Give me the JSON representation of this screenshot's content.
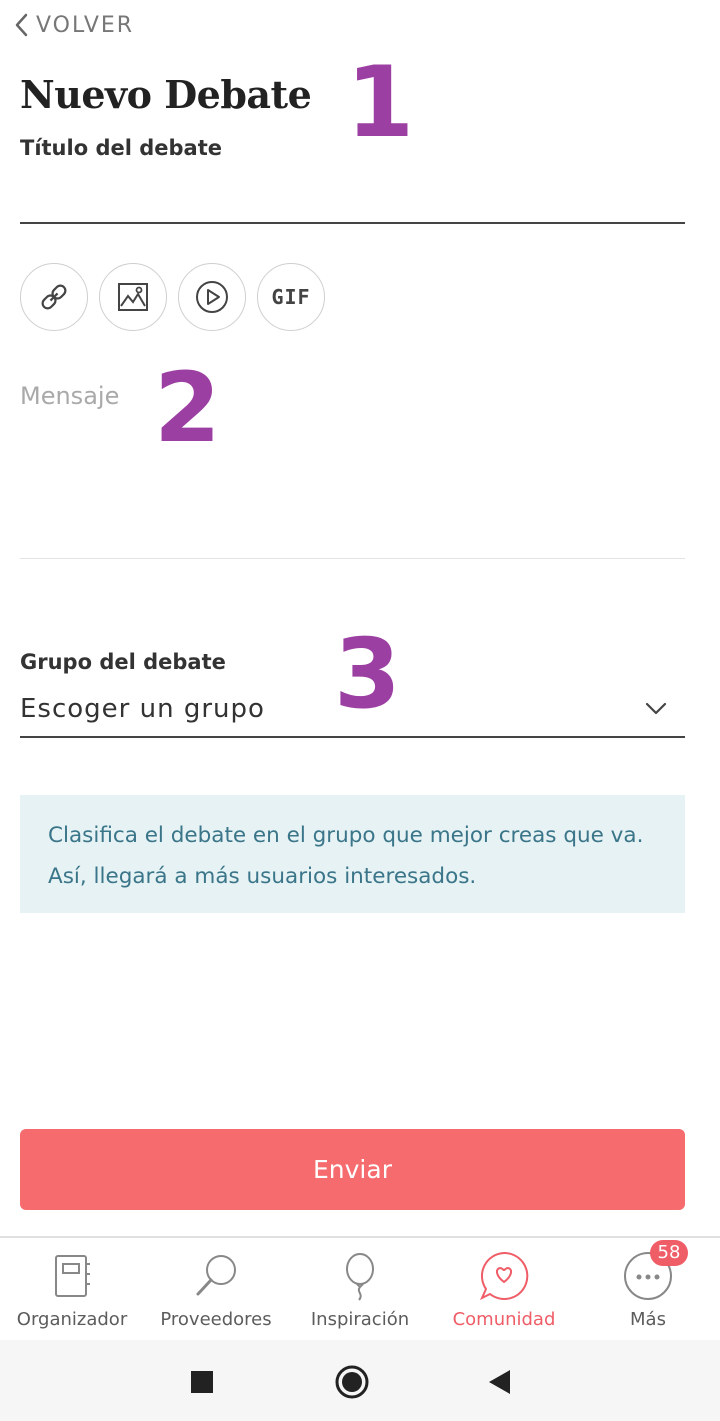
{
  "header": {
    "back_label": "VOLVER",
    "title": "Nuevo Debate"
  },
  "form": {
    "title_label": "Título del debate",
    "title_value": "",
    "toolbar": {
      "buttons": [
        {
          "name": "link",
          "icon": "link-icon"
        },
        {
          "name": "image",
          "icon": "image-icon"
        },
        {
          "name": "video",
          "icon": "play-icon"
        },
        {
          "name": "gif",
          "icon": "gif-icon",
          "label": "GIF"
        }
      ]
    },
    "message_placeholder": "Mensaje",
    "group_label": "Grupo del debate",
    "group_selected": "Escoger un grupo",
    "info_line1": "Clasifica el debate en el grupo que mejor creas que va.",
    "info_line2": "Así, llegará a más usuarios interesados.",
    "submit_label": "Enviar"
  },
  "annotations": {
    "one": "1",
    "two": "2",
    "three": "3"
  },
  "tabbar": {
    "items": [
      {
        "label": "Organizador",
        "icon": "notebook-icon",
        "active": false
      },
      {
        "label": "Proveedores",
        "icon": "magnifier-icon",
        "active": false
      },
      {
        "label": "Inspiración",
        "icon": "balloon-icon",
        "active": false
      },
      {
        "label": "Comunidad",
        "icon": "chat-heart-icon",
        "active": true
      },
      {
        "label": "Más",
        "icon": "more-icon",
        "active": false,
        "badge": "58"
      }
    ]
  },
  "system_nav": {
    "buttons": [
      "square-icon",
      "home-circle-icon",
      "back-triangle-icon"
    ]
  },
  "colors": {
    "accent": "#f56b6e",
    "annotation": "#9c3fa2",
    "info_bg": "#e6f2f3",
    "info_text": "#3a7589"
  }
}
